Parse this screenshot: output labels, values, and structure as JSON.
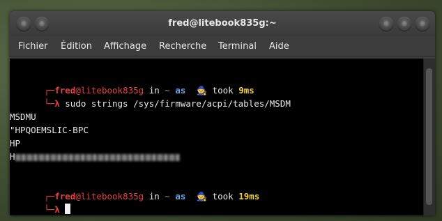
{
  "window": {
    "title": "fred@litebook835g:~"
  },
  "menu": [
    "Fichier",
    "Édition",
    "Affichage",
    "Recherche",
    "Terminal",
    "Aide"
  ],
  "terminal": {
    "prompt1": {
      "corner": "┌─",
      "user": "fred",
      "at": "@",
      "host": "litebook835g",
      "in": " in ",
      "dir": "~",
      "as": " as ",
      "wizard": "🧙",
      "took": " took ",
      "time": "9ms",
      "lambda_corner": "└─",
      "lambda": "λ",
      "command": " sudo strings /sys/firmware/acpi/tables/MSDM"
    },
    "output": [
      "MSDMU",
      "\"HPQOEMSLIC-BPC",
      "HP",
      "H"
    ],
    "prompt2": {
      "corner": "┌─",
      "user": "fred",
      "at": "@",
      "host": "litebook835g",
      "in": " in ",
      "dir": "~",
      "as": " as ",
      "wizard": "🧙",
      "took": " took ",
      "time": "19ms",
      "lambda_corner": "└─",
      "lambda": "λ"
    }
  },
  "colors": {
    "user": "#e84040",
    "dir": "#8a8a8a",
    "as": "#6aa6e8",
    "time": "#f0d040"
  }
}
